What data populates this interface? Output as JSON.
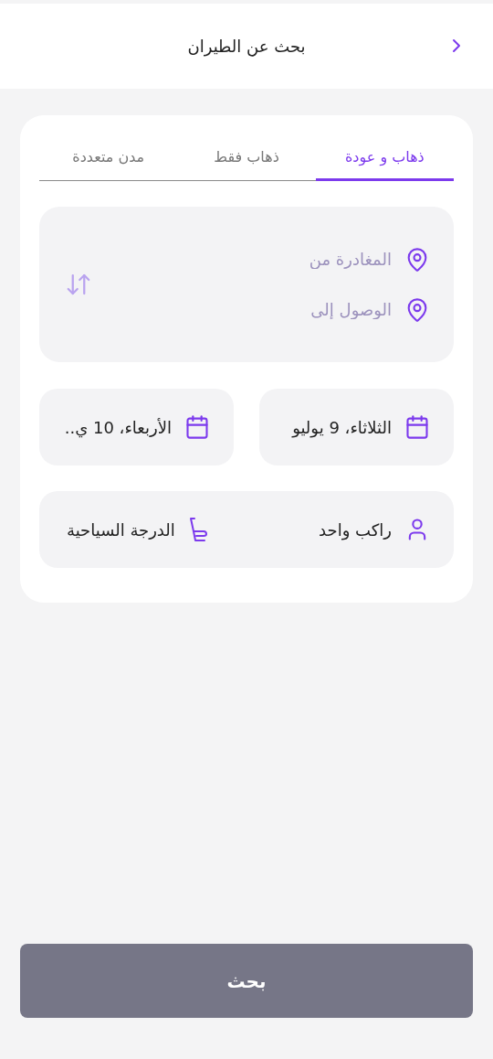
{
  "header": {
    "title": "بحث عن الطيران"
  },
  "tabs": [
    {
      "label": "ذهاب و عودة",
      "selected": true
    },
    {
      "label": "ذهاب فقط",
      "selected": false
    },
    {
      "label": "مدن متعددة",
      "selected": false
    }
  ],
  "route": {
    "from": {
      "placeholder": "المغادرة من"
    },
    "to": {
      "placeholder": "الوصول إلى"
    }
  },
  "dates": [
    {
      "value": "الثلاثاء، 9 يوليو"
    },
    {
      "value": "الأربعاء، 10 ي.."
    }
  ],
  "travellers": {
    "passengers": "راكب واحد",
    "cabin_class": "الدرجة السياحية"
  },
  "search_button": {
    "label": "بحث",
    "disabled": true
  }
}
